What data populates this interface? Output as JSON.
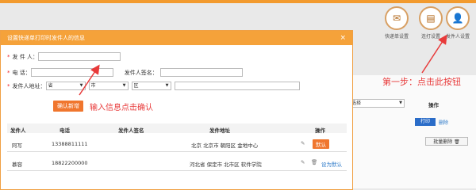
{
  "toolbar": {
    "items": [
      {
        "label": "快递单设置",
        "icon": "envelope-icon"
      },
      {
        "label": "连打设置",
        "icon": "printer-icon"
      },
      {
        "label": "发件人设置",
        "icon": "user-icon"
      }
    ]
  },
  "annotation": {
    "step_one": "第一步：点击此按钮",
    "confirm_hint": "输入信息点击确认"
  },
  "dialog": {
    "title": "设置快递单打印时发件人的信息",
    "close": "×",
    "fields": {
      "sender_label": "发  件  人：",
      "phone_label": "电      话：",
      "signature_label": "发件人签名：",
      "address_label": "发件人地址：",
      "province_value": "省",
      "city_value": "市",
      "district_value": "区"
    },
    "confirm_button": "确认新增",
    "table": {
      "headers": [
        "发件人",
        "电话",
        "发件人签名",
        "发件地址",
        "操作"
      ],
      "rows": [
        {
          "name": "阿写",
          "phone": "13388811111",
          "signature": "",
          "address": "北京 北京市 朝阳区 金地中心",
          "action": "默认"
        },
        {
          "name": "慕容",
          "phone": "18822200000",
          "signature": "",
          "address": "河北省 保定市 北市区 软件学院",
          "action": "设为默认"
        }
      ]
    }
  },
  "background": {
    "select_value": "选择",
    "op_header": "操作",
    "print_button": "打印",
    "delete_link": "删除",
    "bulk_delete": "批量删除"
  },
  "colors": {
    "accent": "#f29a2e",
    "button": "#f0762e",
    "annotation": "#e83a3a",
    "link": "#2a78c8"
  }
}
